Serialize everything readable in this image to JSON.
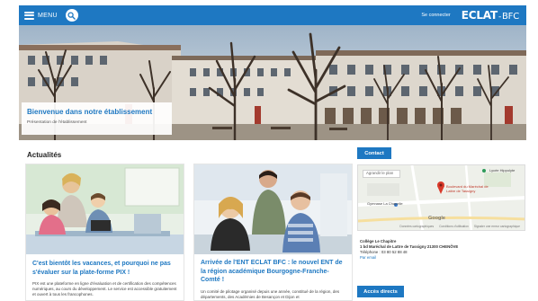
{
  "colors": {
    "primary": "#1e78c2",
    "white": "#ffffff",
    "title_text": "#222222"
  },
  "header": {
    "menu_label": "MENU",
    "menu_icon": "hamburger-icon",
    "search_icon": "search-icon",
    "login_label": "Se connecter",
    "logo": {
      "eclat": "ECLAT",
      "dash": "-",
      "bfc": "BFC"
    }
  },
  "hero": {
    "title": "Bienvenue dans notre établissement",
    "subtitle": "Présentation de l'établissement"
  },
  "news": {
    "section_title": "Actualités",
    "cards": [
      {
        "title": "C'est bientôt les vacances, et pourquoi ne pas s'évaluer sur la plate-forme PIX !",
        "text": "PIX est une plateforme en ligne d'évaluation et de certification des compétences numériques, au cours du développement. Le service est accessible gratuitement et ouvert à tous les francophones."
      },
      {
        "title": "Arrivée de l'ENT ECLAT BFC : le nouvel ENT de la région académique Bourgogne-Franche-Comté !",
        "text": "Un comité de pilotage organisé depuis une année, constitué de la région, des départements, des Académies de Besançon et Dijon et"
      }
    ]
  },
  "contact": {
    "button_label": "Contact",
    "map": {
      "search_placeholder": "Agrandir le plan",
      "pin_label": "Boulevard du Maréchal de Lattre de Tassigny",
      "poi_top": "Lycée Hippolyte",
      "poi_left": "Gymnase La Chapelle",
      "google": "Google",
      "footer": [
        "Données cartographiques",
        "Conditions d'utilisation",
        "Signaler une erreur cartographique"
      ]
    },
    "address": {
      "name": "Collège Le Chapitre",
      "line": "1 bd Maréchal de Lattre de Tassigny 21300 CHENÔVE",
      "phone": "Téléphone : 03 80 52 88 48",
      "link": "Par email"
    }
  },
  "direct_access": {
    "button_label": "Accès directs"
  }
}
